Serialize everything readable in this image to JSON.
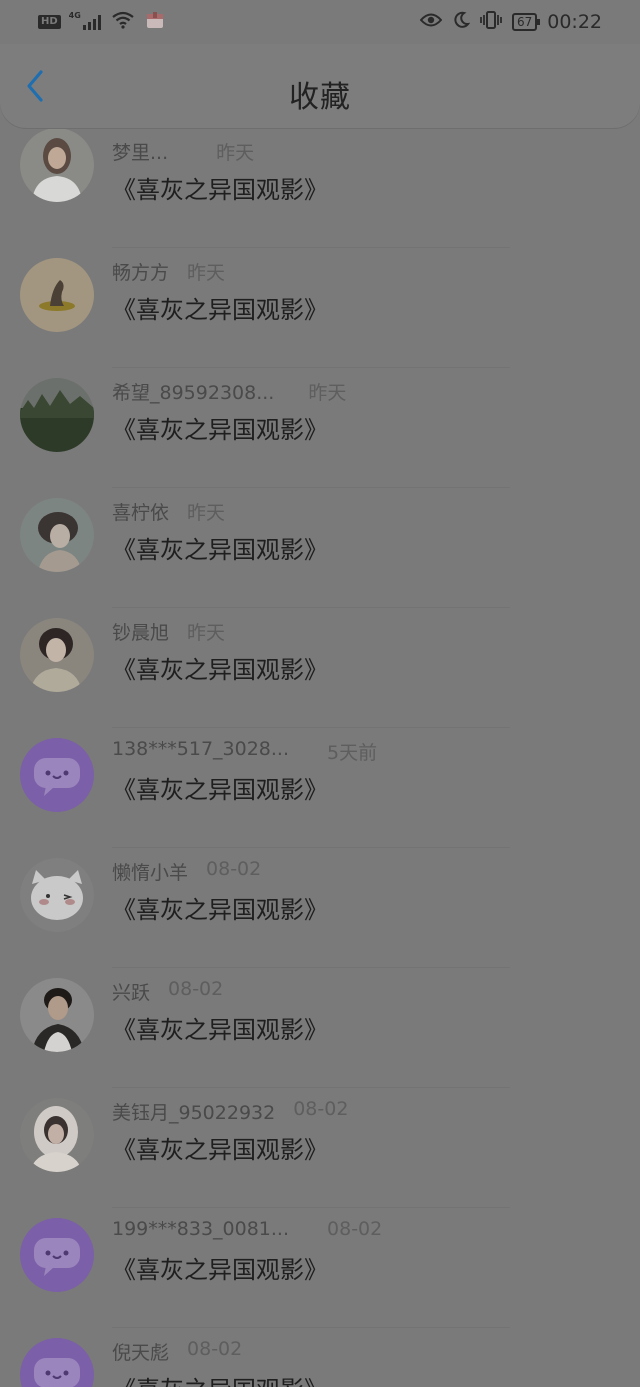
{
  "status_bar": {
    "hd": "HD",
    "network": "4G",
    "battery": "67",
    "time": "00:22"
  },
  "header": {
    "title": "收藏",
    "back_icon": "chevron-left-icon"
  },
  "colors": {
    "accent": "#1f6fb0",
    "dim_overlay": "#7a7a7a",
    "default_avatar": "#7b5fa8"
  },
  "items": [
    {
      "name": "梦里...",
      "time": "昨天",
      "content": "《喜灰之异国观影》",
      "avatar": "photo-woman-white-shirt"
    },
    {
      "name": "畅方方",
      "time": "昨天",
      "content": "《喜灰之异国观影》",
      "avatar": "photo-figure-on-mat"
    },
    {
      "name": "希望_89592308...",
      "time": "昨天",
      "content": "《喜灰之异国观影》",
      "avatar": "photo-forest-hills"
    },
    {
      "name": "喜柠依",
      "time": "昨天",
      "content": "《喜灰之异国观影》",
      "avatar": "photo-anime-girl"
    },
    {
      "name": "钞晨旭",
      "time": "昨天",
      "content": "《喜灰之异国观影》",
      "avatar": "photo-woman-short-hair"
    },
    {
      "name": "138***517_3028...",
      "time": "5天前",
      "content": "《喜灰之异国观影》",
      "avatar": "default-chat-bubble"
    },
    {
      "name": "懒惰小羊",
      "time": "08-02",
      "content": "《喜灰之异国观影》",
      "avatar": "cartoon-cat"
    },
    {
      "name": "兴跃",
      "time": "08-02",
      "content": "《喜灰之异国观影》",
      "avatar": "photo-man-dark-hair"
    },
    {
      "name": "美钰月_95022932",
      "time": "08-02",
      "content": "《喜灰之异国观影》",
      "avatar": "photo-woman-hood"
    },
    {
      "name": "199***833_0081...",
      "time": "08-02",
      "content": "《喜灰之异国观影》",
      "avatar": "default-chat-bubble"
    },
    {
      "name": "倪天彪",
      "time": "08-02",
      "content": "《喜灰之异国观影》",
      "avatar": "default-chat-bubble"
    }
  ]
}
